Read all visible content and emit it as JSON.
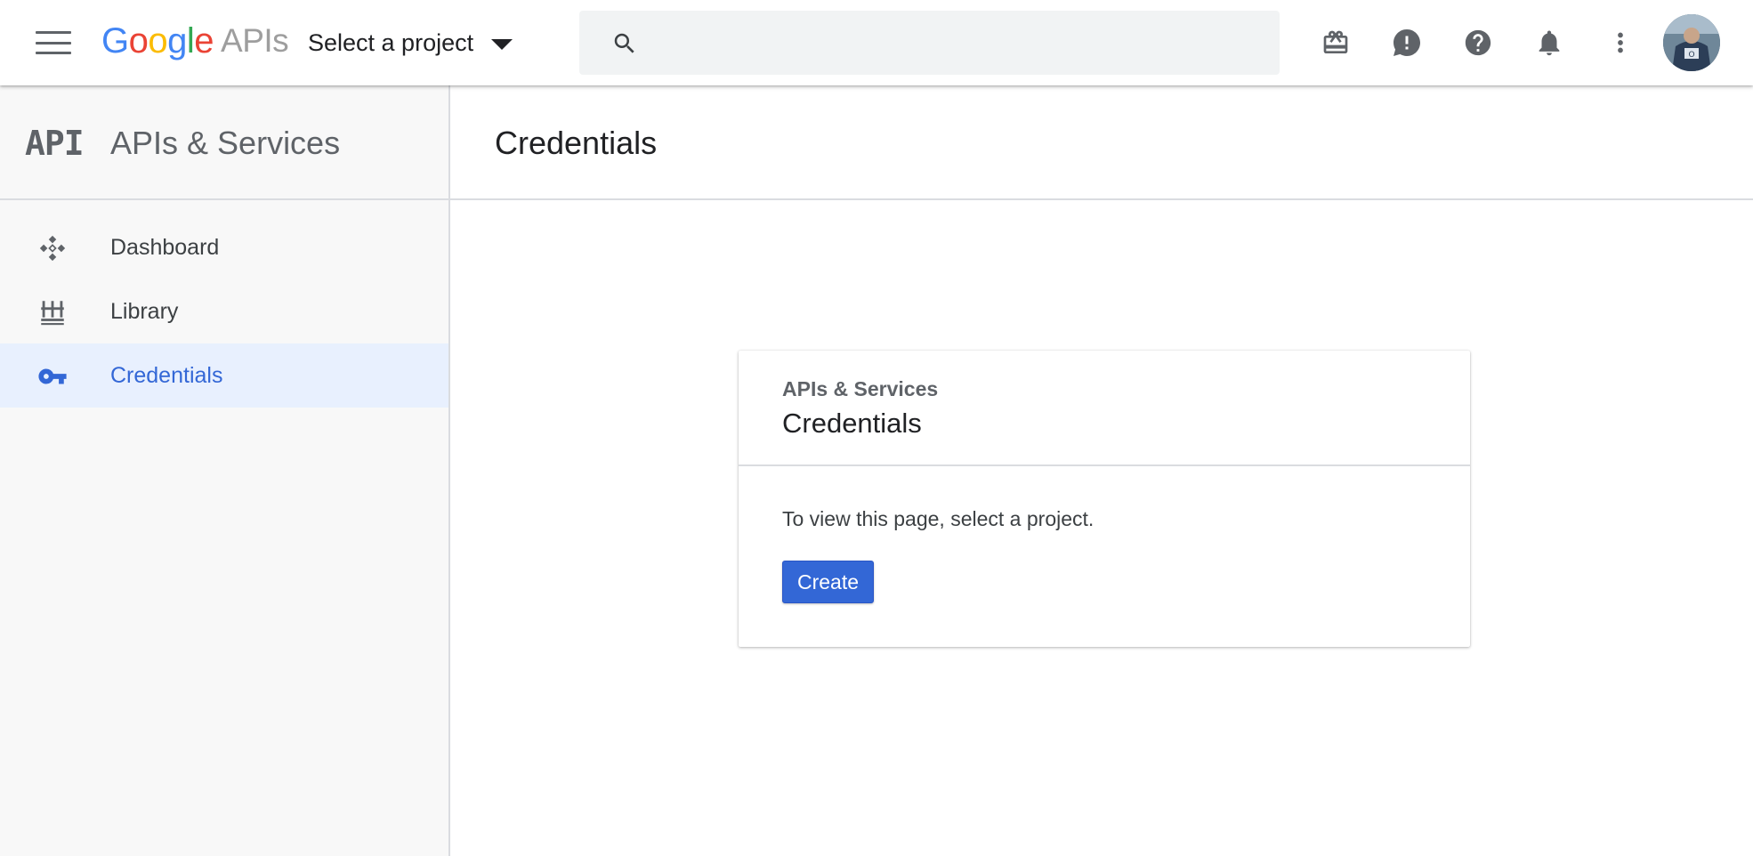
{
  "topbar": {
    "brand_letters": [
      "G",
      "o",
      "o",
      "g",
      "l",
      "e"
    ],
    "brand_suffix": "APIs",
    "project_selector_label": "Select a project",
    "search": {
      "value": "",
      "placeholder": ""
    },
    "icons": [
      "menu-icon",
      "search-icon",
      "gift-icon",
      "feedback-icon",
      "help-icon",
      "notifications-icon",
      "more-vert-icon",
      "avatar"
    ]
  },
  "sidebar": {
    "logo_text": "API",
    "title": "APIs & Services",
    "items": [
      {
        "label": "Dashboard",
        "icon": "dashboard-icon",
        "active": false
      },
      {
        "label": "Library",
        "icon": "library-icon",
        "active": false
      },
      {
        "label": "Credentials",
        "icon": "key-icon",
        "active": true
      }
    ]
  },
  "main": {
    "title": "Credentials",
    "card": {
      "subtitle": "APIs & Services",
      "title": "Credentials",
      "message": "To view this page, select a project.",
      "create_label": "Create"
    }
  },
  "colors": {
    "accent": "#3367d6",
    "active_nav_bg": "#e8f0fe",
    "sidebar_bg": "#f8f8f8",
    "icon_gray": "#5f6368"
  }
}
